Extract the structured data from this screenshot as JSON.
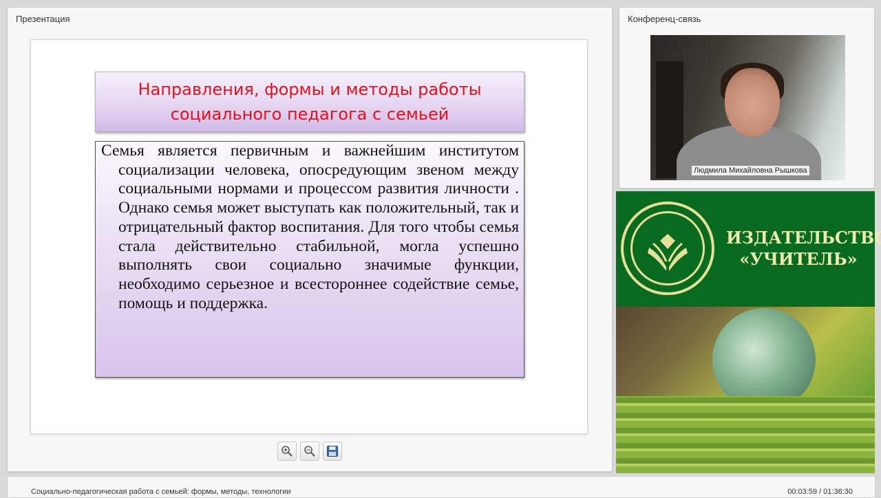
{
  "presentation": {
    "title": "Презентация",
    "slide_title": "Направления, формы и методы работы социального педагога с семьей",
    "slide_body_first": "Семья является первичным и важнейшим",
    "slide_body_rest": "институтом социализации человека, опосредующим звеном между социальными нормами и процессом развития личности . Однако семья может выступать как положительный, так и отрицательный фактор воспитания. Для того чтобы семья стала действительно стабильной, могла успешно выполнять свои социально значимые функции, необходимо серьезное и всестороннее содействие семье, помощь и поддержка."
  },
  "toolbar": {
    "zoom_in_icon": "zoom-in-icon",
    "zoom_out_icon": "zoom-out-icon",
    "save_icon": "floppy-disk-icon"
  },
  "conference": {
    "title": "Конференц-связь",
    "speaker_name": "Людмила Михайловна Рышкова"
  },
  "ad": {
    "publisher_line1": "ИЗДАТЕЛЬСТВО",
    "publisher_line2": "«УЧИТЕЛЬ»",
    "brand_color": "#0a6a1f",
    "text_color": "#ecebb0"
  },
  "footer": {
    "course_title": "Социально-педагогическая работа с семьей: формы, методы, технологии",
    "time": "00:03:59 / 01:36:30"
  }
}
